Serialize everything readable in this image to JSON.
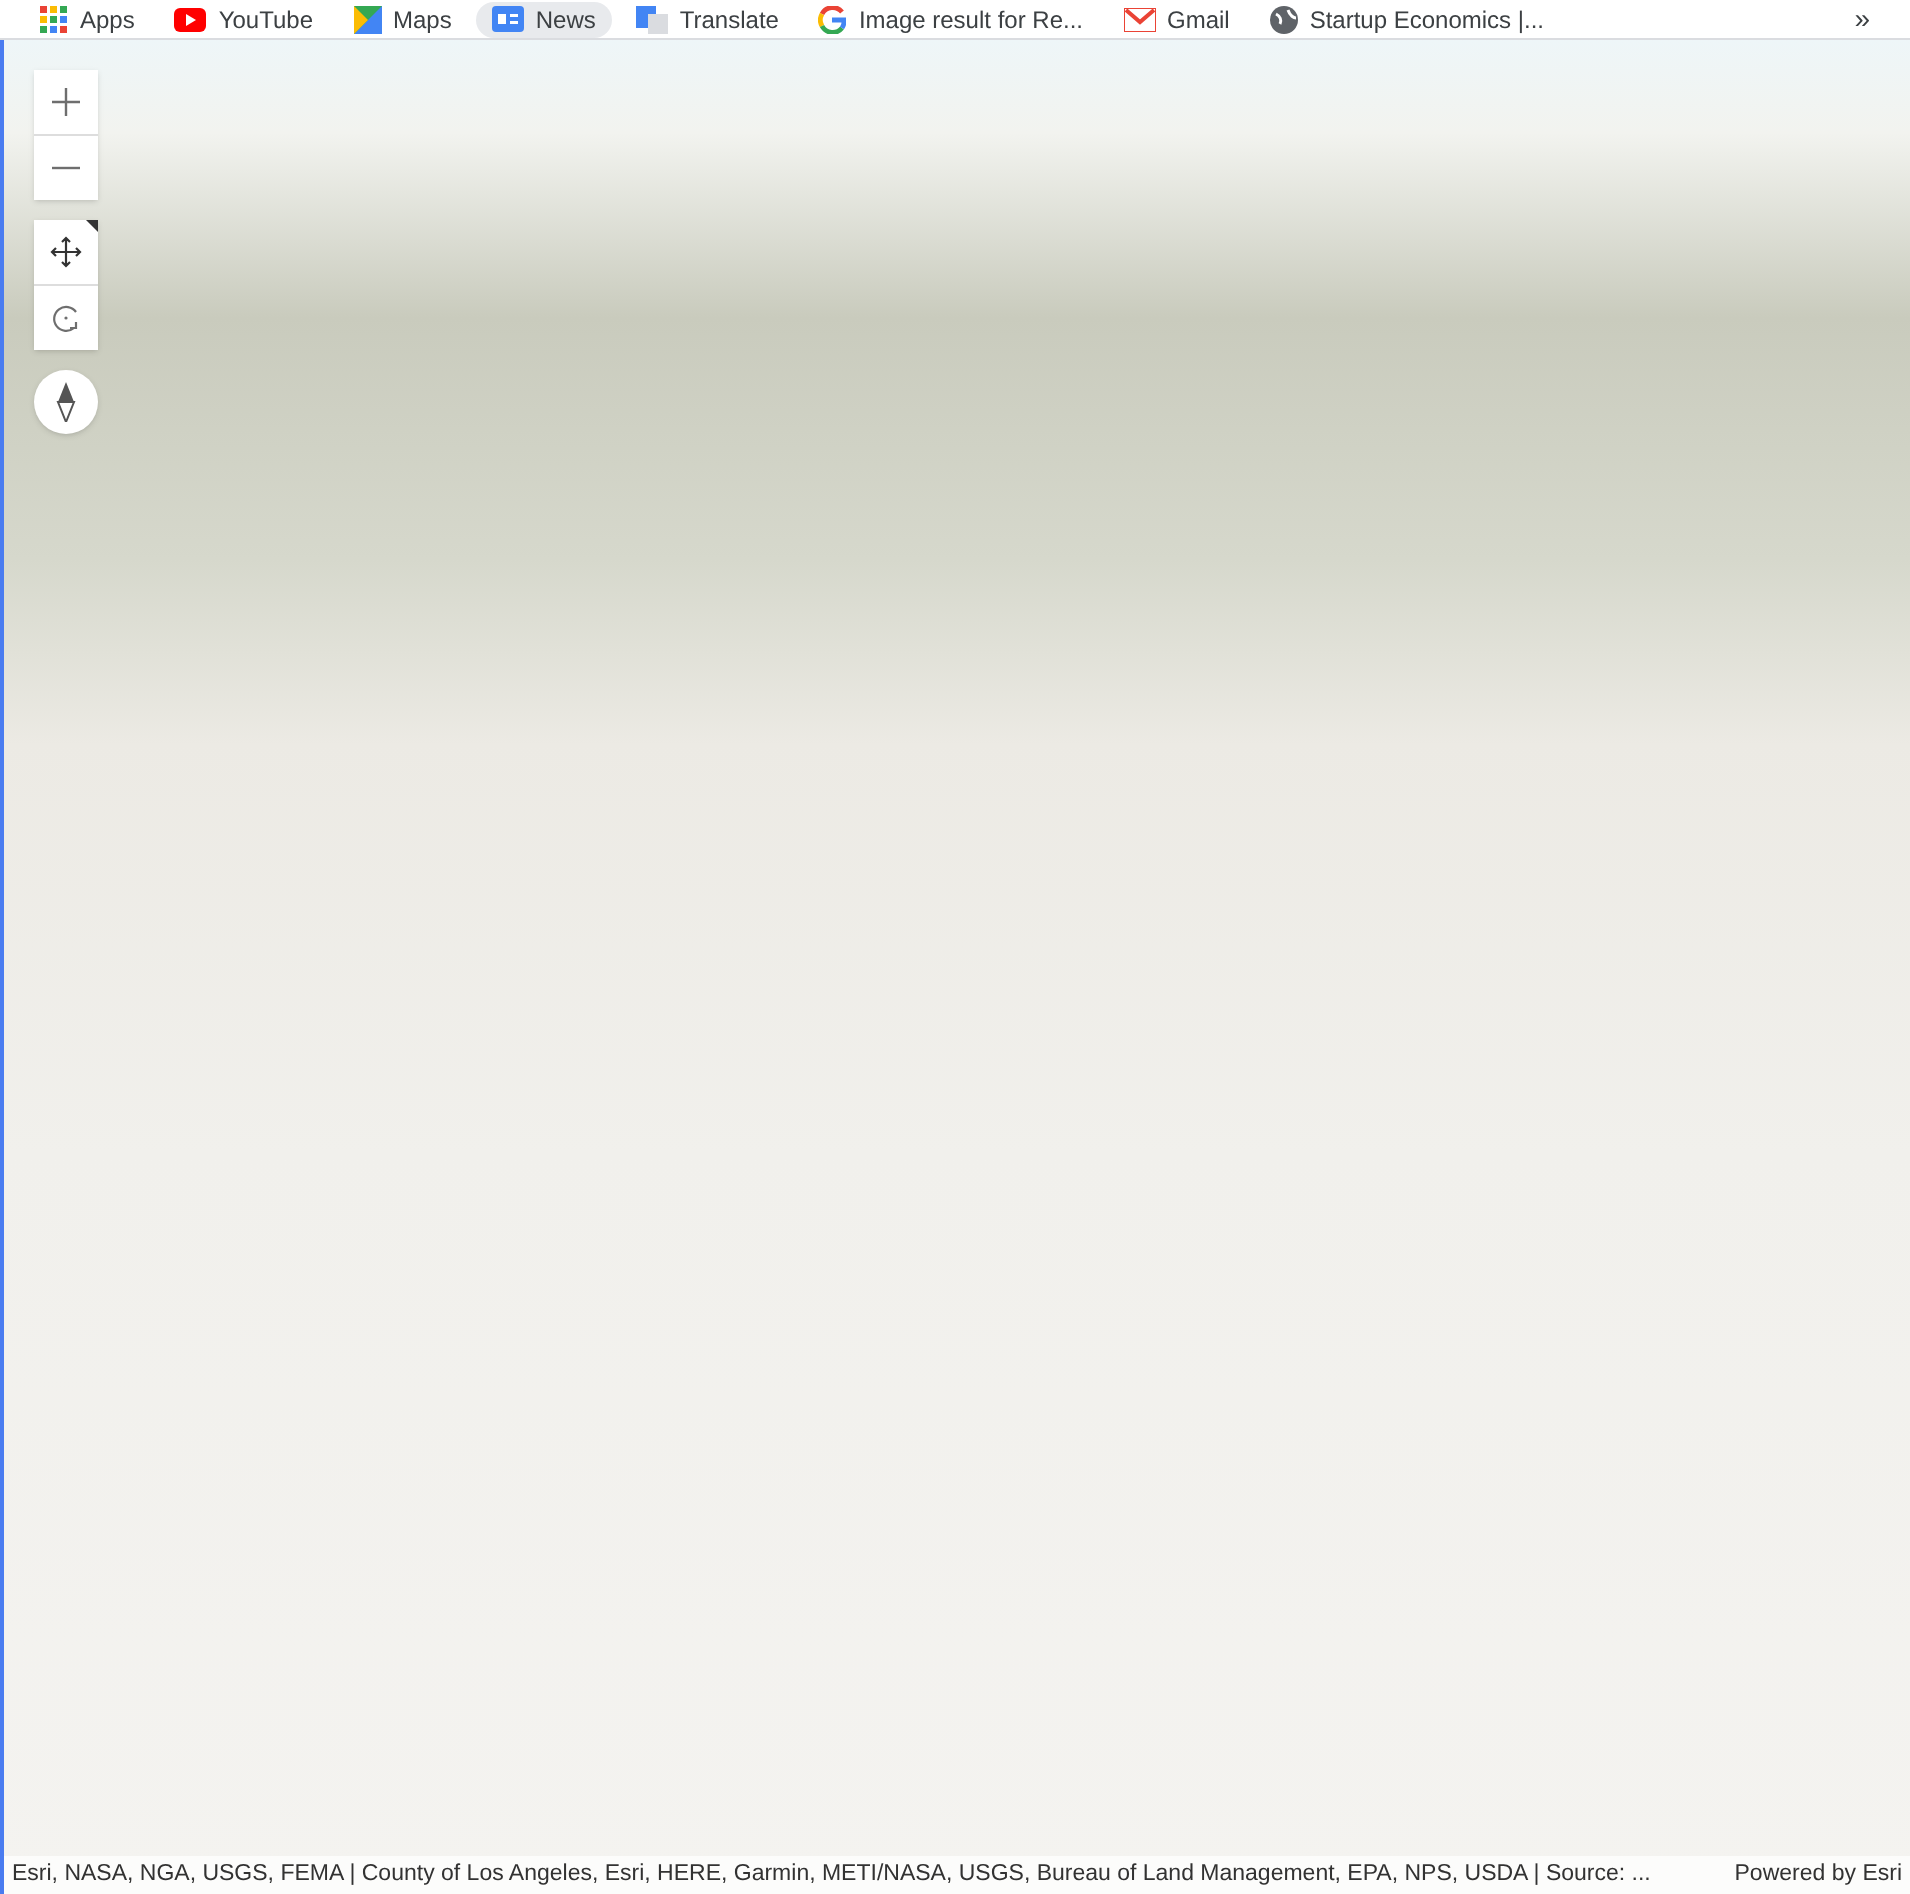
{
  "bookmarks_bar": {
    "items": [
      {
        "kind": "apps",
        "label": "Apps",
        "selected": false
      },
      {
        "kind": "youtube",
        "label": "YouTube",
        "selected": false
      },
      {
        "kind": "maps",
        "label": "Maps",
        "selected": false
      },
      {
        "kind": "news",
        "label": "News",
        "selected": true
      },
      {
        "kind": "translate",
        "label": "Translate",
        "selected": false
      },
      {
        "kind": "google",
        "label": "Image result for Re...",
        "selected": false
      },
      {
        "kind": "gmail",
        "label": "Gmail",
        "selected": false
      },
      {
        "kind": "globe",
        "label": "Startup Economics |...",
        "selected": false
      }
    ],
    "overflow": "»"
  },
  "map": {
    "attribution": "Esri, NASA, NGA, USGS, FEMA | County of Los Angeles, Esri, HERE, Garmin, METI/NASA, USGS, Bureau of Land Management, EPA, NPS, USDA | Source: ...",
    "powered_by": "Powered by Esri"
  }
}
